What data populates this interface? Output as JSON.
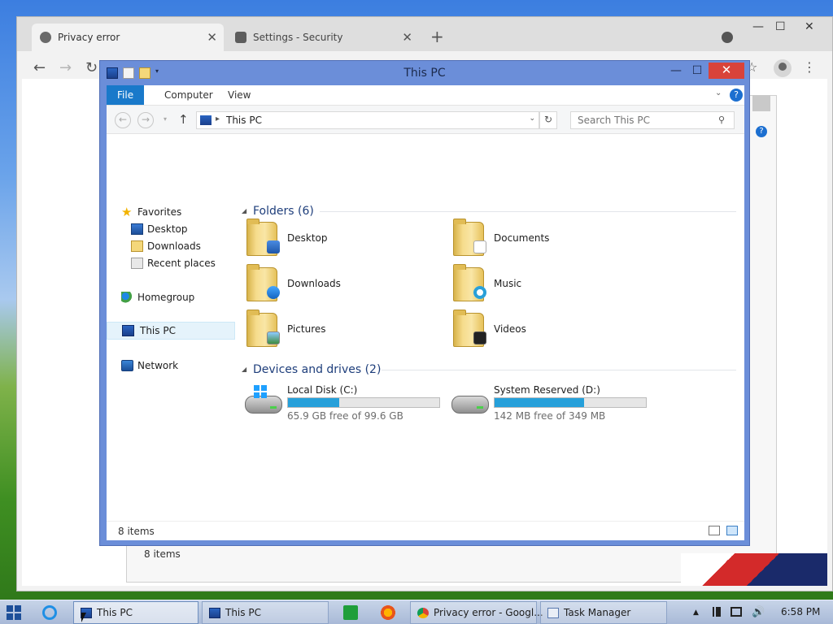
{
  "chrome": {
    "tabs": [
      {
        "label": "Privacy error",
        "active": true,
        "icon": "globe-icon"
      },
      {
        "label": "Settings - Security",
        "active": false,
        "icon": "gear-icon"
      }
    ],
    "close_glyph": "✕",
    "new_tab_glyph": "+",
    "back_glyph": "←",
    "forward_glyph": "→",
    "reload_glyph": "↻",
    "menu_glyph": "⋮",
    "star_glyph": "☆",
    "win_controls": {
      "minimize": "—",
      "maximize": "☐",
      "close": "✕"
    },
    "background_status": "8 items",
    "help_glyph": "?"
  },
  "explorer": {
    "title": "This PC",
    "controls": {
      "minimize": "—",
      "maximize": "☐",
      "close": "✕"
    },
    "ribbon_tabs": [
      "File",
      "Computer",
      "View"
    ],
    "ribbon_chevron": "⌄",
    "help_glyph": "?",
    "nav": {
      "back_glyph": "←",
      "forward_glyph": "→",
      "recent_glyph": "▾",
      "up_glyph": "↑",
      "address_sep": "▸",
      "address": "This PC",
      "address_dd": "⌄",
      "refresh_glyph": "↻",
      "search_placeholder": "Search This PC",
      "search_glyph": "⚲"
    },
    "nav_pane": {
      "favorites": {
        "label": "Favorites",
        "glyph": "★",
        "icon": "star-icon"
      },
      "favorite_items": [
        {
          "label": "Desktop",
          "icon": "desktop-icon"
        },
        {
          "label": "Downloads",
          "icon": "downloads-icon"
        },
        {
          "label": "Recent places",
          "icon": "recent-places-icon"
        }
      ],
      "homegroup": {
        "label": "Homegroup",
        "icon": "homegroup-icon"
      },
      "this_pc": {
        "label": "This PC",
        "icon": "computer-icon",
        "selected": true
      },
      "network": {
        "label": "Network",
        "icon": "network-icon"
      }
    },
    "folders_group": {
      "label": "Folders (6)",
      "toggle": "◢"
    },
    "folders": [
      {
        "name": "Desktop",
        "icon": "desktop-folder-icon"
      },
      {
        "name": "Documents",
        "icon": "documents-folder-icon"
      },
      {
        "name": "Downloads",
        "icon": "downloads-folder-icon"
      },
      {
        "name": "Music",
        "icon": "music-folder-icon"
      },
      {
        "name": "Pictures",
        "icon": "pictures-folder-icon"
      },
      {
        "name": "Videos",
        "icon": "videos-folder-icon"
      }
    ],
    "drives_group": {
      "label": "Devices and drives (2)",
      "toggle": "◢"
    },
    "drives": [
      {
        "name": "Local Disk (C:)",
        "free_text": "65.9 GB free of 99.6 GB",
        "used_fraction": 0.338,
        "icon": "system-drive-icon"
      },
      {
        "name": "System Reserved (D:)",
        "free_text": "142 MB free of 349 MB",
        "used_fraction": 0.593,
        "icon": "drive-icon"
      }
    ],
    "status_text": "8 items"
  },
  "taskbar": {
    "buttons": [
      {
        "label": "This PC",
        "active": true,
        "icon": "computer-icon"
      },
      {
        "label": "This PC",
        "active": false,
        "icon": "computer-icon"
      },
      {
        "label": "Privacy error - Googl...",
        "active": false,
        "icon": "chrome-icon"
      },
      {
        "label": "Task Manager",
        "active": false,
        "icon": "task-manager-icon"
      }
    ],
    "tray_up_glyph": "▲",
    "volume_glyph": "🔊",
    "clock": "6:58 PM"
  },
  "colors": {
    "accent": "#1979ca",
    "drive_bar": "#26a0da",
    "title_bar": "#6b8ed9",
    "close_red": "#d9433a"
  }
}
